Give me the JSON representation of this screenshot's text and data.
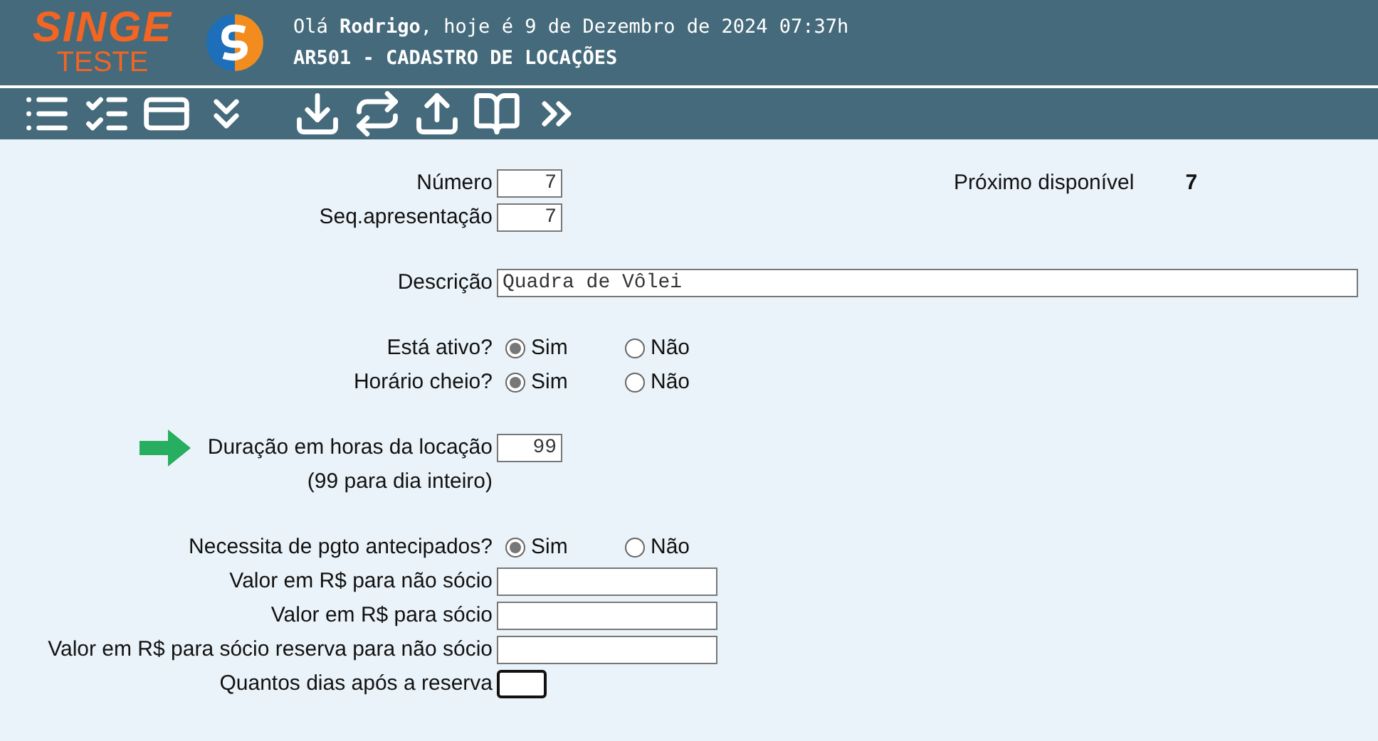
{
  "header": {
    "brand": "SINGE",
    "brand_sub": "TESTE",
    "greeting": "Olá **Rodrigo**, hoje é 9 de Dezembro de 2024 07:37h",
    "title": "AR501 - CADASTRO DE LOCAÇÕES"
  },
  "next_available": {
    "label": "Próximo disponível",
    "value": "7"
  },
  "sections": [
    [
      {
        "kind": "short",
        "label": "Número",
        "value": "7"
      },
      {
        "kind": "short",
        "label": "Seq.apresentação",
        "value": "7"
      }
    ],
    [
      {
        "kind": "text",
        "label": "Descrição",
        "value": "Quadra de Vôlei"
      }
    ],
    [
      {
        "kind": "radio",
        "label": "Está ativo?",
        "options": [
          {
            "label": "Sim",
            "selected": true
          },
          {
            "label": "Não",
            "selected": false
          }
        ]
      },
      {
        "kind": "radio",
        "label": "Horário cheio?",
        "options": [
          {
            "label": "Sim",
            "selected": true
          },
          {
            "label": "Não",
            "selected": false
          }
        ]
      }
    ],
    [
      {
        "kind": "short",
        "label": "Duração em horas da locação",
        "value": "99",
        "highlighted": true
      },
      {
        "kind": "hint",
        "label": "(99 para dia inteiro)"
      }
    ],
    [
      {
        "kind": "radio",
        "label": "Necessita de pgto antecipados?",
        "options": [
          {
            "label": "Sim",
            "selected": true
          },
          {
            "label": "Não",
            "selected": false
          }
        ]
      },
      {
        "kind": "money",
        "label": "Valor em R$ para não sócio"
      },
      {
        "kind": "money",
        "label": "Valor em R$ para sócio"
      },
      {
        "kind": "money",
        "label": "Valor em R$ para sócio reserva para não sócio"
      },
      {
        "kind": "tiny",
        "label": "Quantos dias após a reserva",
        "focused": true
      }
    ]
  ]
}
